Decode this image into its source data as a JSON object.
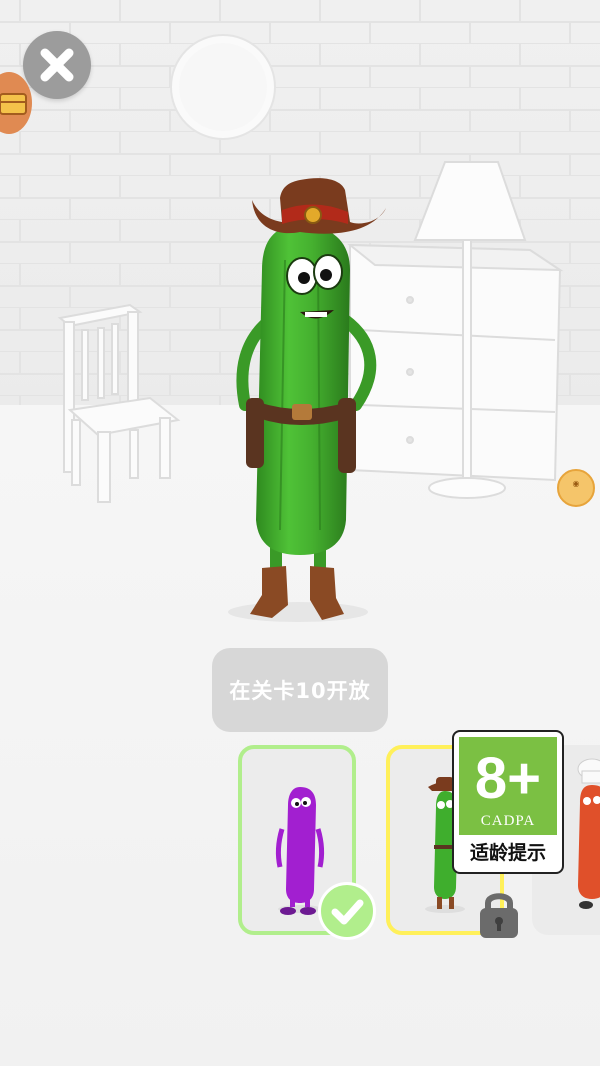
{
  "close_button": {
    "icon": "close-icon"
  },
  "treasure_button": {
    "icon": "treasure-chest-icon"
  },
  "side_badge": {
    "icon": "coin-badge-icon"
  },
  "unlock_tip": {
    "text": "在关卡10开放"
  },
  "skins": [
    {
      "name": "purple-pickle",
      "state": "selected",
      "border_color": "#b1ee8c"
    },
    {
      "name": "cowboy-pickle",
      "state": "locked",
      "border_color": "#fff05a"
    },
    {
      "name": "chef-sausage",
      "state": "partial",
      "border_color": ""
    }
  ],
  "age_rating": {
    "number": "8+",
    "org": "CADPA",
    "label": "适龄提示",
    "color": "#7bc043"
  },
  "colors": {
    "pickle_green": "#3fae2d",
    "hat_brown": "#7a3b1e",
    "accent_green": "#b1ee8c",
    "accent_yellow": "#fff05a"
  }
}
